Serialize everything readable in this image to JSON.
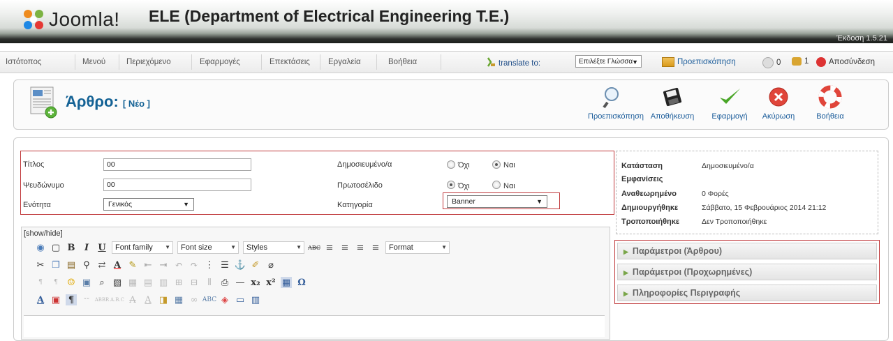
{
  "header": {
    "logo_text": "Joomla!",
    "site_title": "ELE (Department of Electrical Engineering T.E.)",
    "version": "Έκδοση 1.5.21"
  },
  "menu": {
    "items": [
      "Ιστότοπος",
      "Μενού",
      "Περιεχόμενο",
      "Εφαρμογές",
      "Επεκτάσεις",
      "Εργαλεία",
      "Βοήθεια"
    ],
    "translate_label": "translate to:",
    "language_select": "Επιλέξτε Γλώσσα",
    "preview": "Προεπισκόπηση",
    "messages_count": "0",
    "users_count": "1",
    "logout": "Αποσύνδεση"
  },
  "toolbar": {
    "title": "Άρθρο:",
    "subtitle": "[ Νέο ]",
    "buttons": [
      "Προεπισκόπηση",
      "Αποθήκευση",
      "Εφαρμογή",
      "Ακύρωση",
      "Βοήθεια"
    ]
  },
  "form": {
    "title_label": "Τίτλος",
    "title_value": "00",
    "alias_label": "Ψευδώνυμο",
    "alias_value": "00",
    "section_label": "Ενότητα",
    "section_value": "Γενικός",
    "published_label": "Δημοσιευμένο/α",
    "frontpage_label": "Πρωτοσέλιδο",
    "category_label": "Κατηγορία",
    "category_value": "Banner",
    "no_label": "Όχι",
    "yes_label": "Ναι"
  },
  "editor": {
    "show_hide": "[show/hide]",
    "font_family": "Font family",
    "font_size": "Font size",
    "styles": "Styles",
    "format": "Format"
  },
  "info": {
    "state_label": "Κατάσταση",
    "state_value": "Δημοσιευμένο/α",
    "hits_label": "Εμφανίσεις",
    "revised_label": "Αναθεωρημένο",
    "revised_value": "0 Φορές",
    "created_label": "Δημιουργήθηκε",
    "created_value": "Σάββατο, 15 Φεβρουάριος 2014 21:12",
    "modified_label": "Τροποποιήθηκε",
    "modified_value": "Δεν Τροποποιήθηκε"
  },
  "panes": [
    "Παράμετροι (Άρθρου)",
    "Παράμετροι (Προχωρημένες)",
    "Πληροφορίες Περιγραφής"
  ],
  "colors": {
    "title_blue": "#146295",
    "highlight_red": "#c0393b",
    "link_blue": "#1b5c9a"
  }
}
